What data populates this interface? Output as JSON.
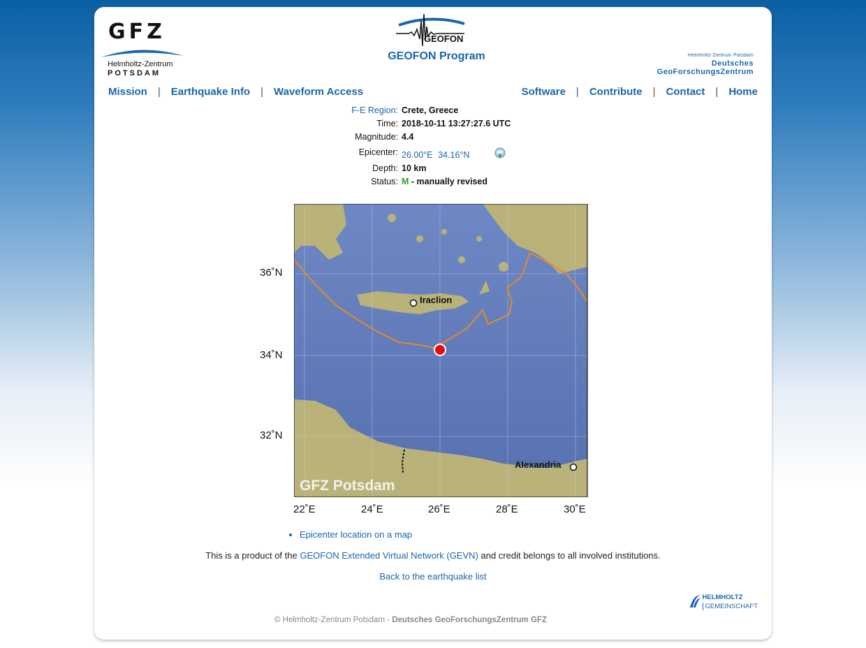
{
  "header": {
    "gfz_logo_text": "GFZ",
    "gfz_sub1": "Helmholtz-Zentrum",
    "gfz_sub2": "Potsdam",
    "geofon_logo_text": "GEOFON",
    "program_title": "GEOFON Program",
    "dgfz_line1": "Helmholtz-Zentrum Potsdam",
    "dgfz_line2": "Deutsches",
    "dgfz_line3": "GeoForschungsZentrum"
  },
  "nav": {
    "left": [
      "Mission",
      "Earthquake Info",
      "Waveform Access"
    ],
    "right": [
      "Software",
      "Contribute",
      "Contact",
      "Home"
    ],
    "separator": "|"
  },
  "event": {
    "region_label": "F-E Region:",
    "region_value": "Crete, Greece",
    "time_label": "Time:",
    "time_value": "2018-10-11 13:27:27.6 UTC",
    "magnitude_label": "Magnitude:",
    "magnitude_value": "4.4",
    "epicenter_label": "Epicenter:",
    "epicenter_lon": "26.00°E",
    "epicenter_lat": "34.16°N",
    "depth_label": "Depth:",
    "depth_value": "10 km",
    "status_label": "Status:",
    "status_code": "M",
    "status_text": "- manually revised"
  },
  "map": {
    "lat_labels": [
      "36˚N",
      "34˚N",
      "32˚N"
    ],
    "lon_labels": [
      "22˚E",
      "24˚E",
      "26˚E",
      "28˚E",
      "30˚E"
    ],
    "city1": "Iraclion",
    "city2": "Alexandria",
    "watermark": "GFZ Potsdam",
    "colors": {
      "sea": "#5f78b8",
      "land": "#b9b279",
      "boundary": "#e28a2b",
      "epicenter": "#e01010"
    }
  },
  "links": {
    "map_link": "Epicenter location on a map",
    "credit_pre": "This is a product of the",
    "credit_link": "GEOFON Extended Virtual Network (GEVN)",
    "credit_post": "and credit belongs to all involved institutions.",
    "back": "Back to the earthquake list"
  },
  "footer": {
    "helmholtz1": "HELMHOLTZ",
    "helmholtz2": "GEMEINSCHAFT",
    "copyright_pre": "© Helmholtz-Zentrum Potsdam -",
    "copyright_bold": "Deutsches GeoForschungsZentrum GFZ"
  }
}
